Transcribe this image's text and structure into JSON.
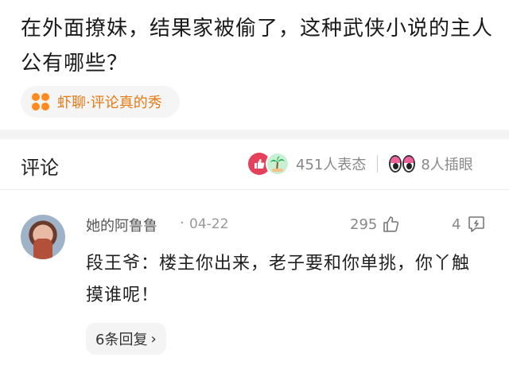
{
  "post": {
    "title": "在外面撩妹，结果家被偷了，这种武侠小说的主人公有哪些？"
  },
  "topic": {
    "icon": "clover-icon",
    "label": "虾聊·评论真的秀",
    "color": "#ff8a1f"
  },
  "comments_section": {
    "title": "评论",
    "reactions_count": "451人表态",
    "eye_roll_count": "8人插眼"
  },
  "comment": {
    "username": "她的阿鲁鲁",
    "separator": "·",
    "date": "04-22",
    "likes": "295",
    "replies": "4",
    "text": "段王爷：楼主你出来，老子要和你单挑，你丫触摸谁呢！",
    "view_replies_label": "6条回复",
    "chevron": "›"
  }
}
